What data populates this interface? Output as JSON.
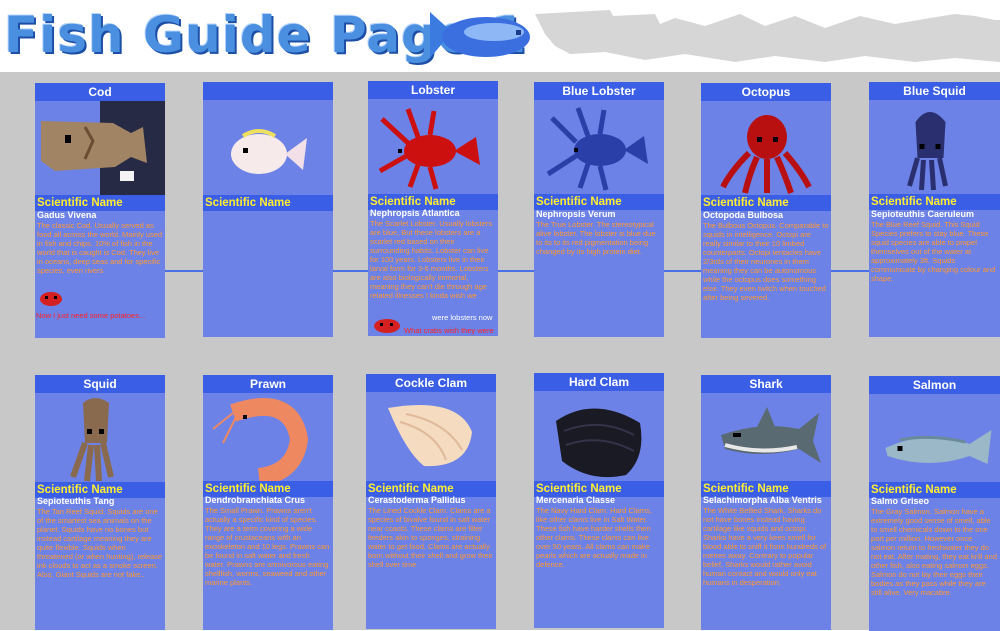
{
  "title": "Fish Guide Page 1",
  "scientific_label": "Scientific Name",
  "colors": {
    "card": "#6d82e6",
    "bar": "#3b5ee6",
    "title": "#4a8fe0",
    "latin": "#ffffff",
    "desc": "#ff9933",
    "label": "#ffee33"
  },
  "cards": [
    {
      "name": "Cod",
      "latin": "Gadus Vivena",
      "desc": "The classic Cod. Usually served as food all across the world. Mainly used in fish and chips. 10% of fish in the world that is caught is Cod. They live in oceans, deep seas and for specific species, even rivers",
      "icon": "cod-icon"
    },
    {
      "name": "",
      "latin": "",
      "desc": "",
      "icon": "pufferfish-icon"
    },
    {
      "name": "Lobster",
      "latin": "Nephropsis Atlantica",
      "desc": "The Scarlet Lobster. Usually lobsters are blue, But these lobsters are a scarlet red based on their surrounding habits. Lobster can live for 100 years. Lobsters live in their larval form for 3-6 months. Lobsters are also biologically immortal, meaning they can't die through age related illnesses I kinda wish we",
      "icon": "red-lobster-icon"
    },
    {
      "name": "Blue Lobster",
      "latin": "Nephropsis Verum",
      "desc": "The True Lobster. The stereotypical alive lobster. The lobster is blue due to its to its red pigmentation being changed by its high protein diet.",
      "icon": "blue-lobster-icon"
    },
    {
      "name": "Octopus",
      "latin": "Octopoda Bulbosa",
      "desc": "The Bulbous Octopus. Comparable to squids in intelligence. Octopi are really similar to their 10 limbed counterparts. Octopi tentacles have 2/3rds of their neurones in them meaning they can be autonomous while the octopus does something else. They even twitch when touched after being severed.",
      "icon": "octopus-icon"
    },
    {
      "name": "Blue Squid",
      "latin": "Sepioteuthis Caeruleum",
      "desc": "The Blue Reef Squid. This Squid Species prefers to stay blue. These squid species are able to propel themselves out of the water at approximately 3ft. Squids communicate by changing colour and shape.",
      "icon": "blue-squid-icon"
    },
    {
      "name": "Squid",
      "latin": "Sepioteuthis Tang",
      "desc": "The Tan Reef Squid. Squids are one of the smartest sea animals on the planet. Squids have no bones but instead cartilage meaning they are quite flexible. Squids when threatened (or when hunting), release ink clouds to act as a smoke screen. Also, Giant Squids are not fake..",
      "icon": "tan-squid-icon"
    },
    {
      "name": "Prawn",
      "latin": "Dendrobranchiata Crus",
      "desc": "The Small Prawn. Prawns aren't actually a specific kind of species. They are a term covering a wide range of crustaceans with an exoskeleton and 10 legs. Prawns can be found in salt water and fresh water. Prawns are omnivorous eating shellfish, worms, seaweed and other marine plants.",
      "icon": "prawn-icon"
    },
    {
      "name": "Cockle Clam",
      "latin": "Cerastoderma Pallidus",
      "desc": "The Lined Cockle Clam. Clams are a species of bivalve found in salt water near coasts. These clams are filter feeders akin to sponges, straining water to get food. Clams are actually born without their shell and grow their shell over time",
      "icon": "cockle-clam-icon"
    },
    {
      "name": "Hard Clam",
      "latin": "Mercenaria Classe",
      "desc": "The Navy Hard Clam. Hard Clams, like other clams live in Salt Water. These fish have harder shells then other clams. These clams can live over 50 years. All clams can make pearls which are actually made in defence.",
      "icon": "hard-clam-icon"
    },
    {
      "name": "Shark",
      "latin": "Selachimorpha Alba Ventris",
      "desc": "The White Bellied Shark. Sharks do not have bones instead having cartilage like squids and octopi. Sharks have a very keen smell for blood able to sniff it from hundreds of metres away. Contrary to popular belief, Sharks would rather avoid human contact and would only eat humans in desperation.",
      "icon": "shark-icon"
    },
    {
      "name": "Salmon",
      "latin": "Salmo Griseo",
      "desc": "The Gray Salmon. Salmon have a extremely good sense of smell, able to smell chemicals down to the one part per million. However once salmon return to freshwater they do not eat. After mating, they eat krill and other fish, also eating salmon eggs. Salmon do not lay their eggs their bodies as they pass while they are still alive. Very macabre.",
      "icon": "salmon-icon"
    }
  ],
  "notes": {
    "cod": "Now I just need some potatoes...",
    "lobster_top": "were lobsters now",
    "lobster_bottom": "What crabs wish they were"
  }
}
